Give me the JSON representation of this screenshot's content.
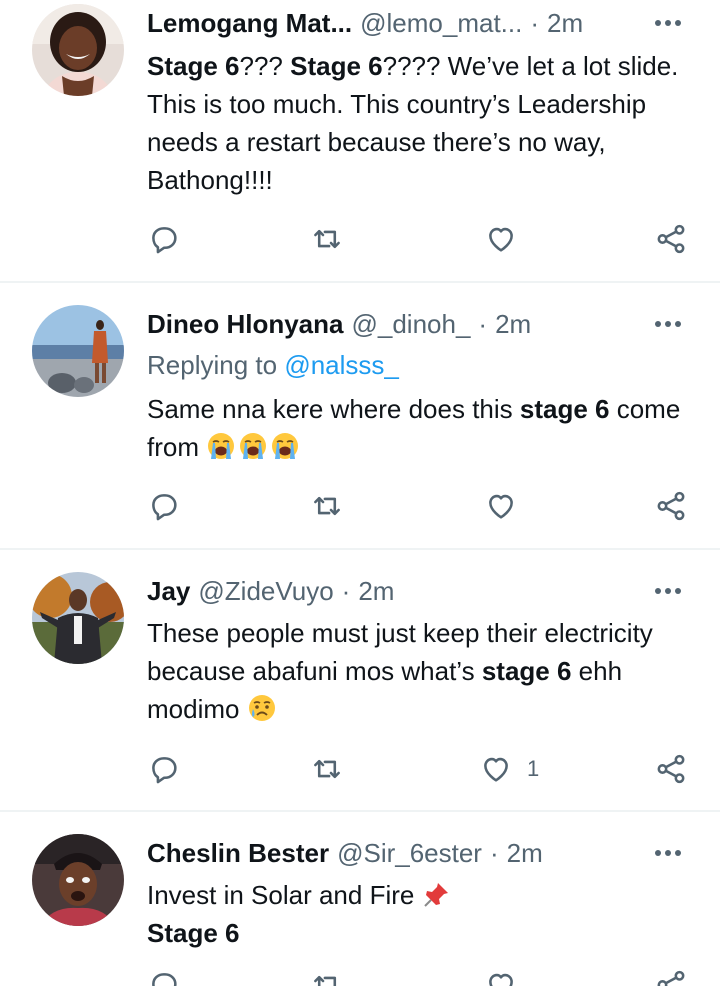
{
  "colors": {
    "text": "#0f1419",
    "secondary": "#536471",
    "link": "#1d9bf0",
    "divider": "#eff3f4"
  },
  "tweets": [
    {
      "name": "Lemogang Mat...",
      "handle": "@lemo_mat...",
      "dot": "·",
      "time": "2m",
      "text": [
        "Stage 6",
        "??? ",
        "Stage 6",
        "???? We’ve let a lot slide. This is too much. This country’s Leadership needs a restart because there’s no way, Bathong!!!!"
      ],
      "avatar": "woman-smiling-avatar"
    },
    {
      "name": "Dineo Hlonyana",
      "handle": "@_dinoh_",
      "dot": "·",
      "time": "2m",
      "replying_prefix": "Replying to ",
      "replying_to": "@nalsss_",
      "text": [
        "Same nna kere where does this ",
        "stage 6",
        " come from "
      ],
      "emoji": [
        "loudly-crying-face",
        "loudly-crying-face",
        "loudly-crying-face"
      ],
      "avatar": "beach-woman-avatar"
    },
    {
      "name": "Jay",
      "handle": "@ZideVuyo",
      "dot": "·",
      "time": "2m",
      "text": [
        "These people must just keep their electricity because abafuni mos what’s ",
        "stage 6",
        " ehh modimo "
      ],
      "emoji": [
        "sad-but-relieved-face"
      ],
      "like_count": "1",
      "avatar": "man-in-suit-avatar"
    },
    {
      "name": "Cheslin Bester",
      "handle": "@Sir_6ester",
      "dot": "·",
      "time": "2m",
      "text": [
        "Invest in Solar and Fire ",
        "Stage 6"
      ],
      "emoji": [
        "pushpin"
      ],
      "avatar": "man-with-cap-avatar"
    }
  ],
  "icons": {
    "reply": "reply-icon",
    "retweet": "retweet-icon",
    "like": "heart-icon",
    "share": "share-icon",
    "more": "more-icon"
  }
}
